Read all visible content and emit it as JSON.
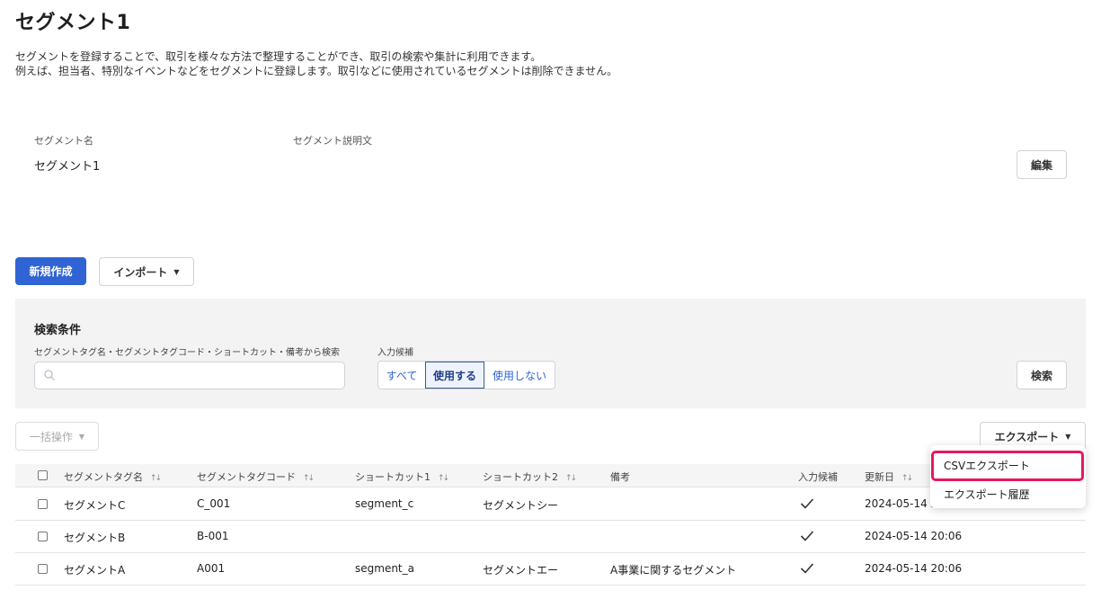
{
  "header": {
    "title": "セグメント1",
    "description_line1": "セグメントを登録することで、取引を様々な方法で整理することができ、取引の検索や集計に利用できます。",
    "description_line2": "例えば、担当者、特別なイベントなどをセグメントに登録します。取引などに使用されているセグメントは削除できません。"
  },
  "info": {
    "name_label": "セグメント名",
    "name_value": "セグメント1",
    "desc_label": "セグメント説明文",
    "edit_button": "編集"
  },
  "actions": {
    "new_button": "新規作成",
    "import_button": "インポート"
  },
  "search": {
    "title": "検索条件",
    "keyword_label": "セグメントタグ名・セグメントタグコード・ショートカット・備考から検索",
    "keyword_value": "",
    "candidate_label": "入力候補",
    "options": [
      "すべて",
      "使用する",
      "使用しない"
    ],
    "selected_option": "使用する",
    "search_button": "検索"
  },
  "toolbar": {
    "bulk_button": "一括操作",
    "export_button": "エクスポート"
  },
  "export_menu": {
    "items": [
      "CSVエクスポート",
      "エクスポート履歴"
    ],
    "highlighted": "CSVエクスポート"
  },
  "table": {
    "columns": [
      "セグメントタグ名",
      "セグメントタグコード",
      "ショートカット1",
      "ショートカット2",
      "備考",
      "入力候補",
      "更新日"
    ],
    "rows": [
      {
        "name": "セグメントC",
        "code": "C_001",
        "shortcut1": "segment_c",
        "shortcut2": "セグメントシー",
        "note": "",
        "candidate": true,
        "updated": "2024-05-14 20:06"
      },
      {
        "name": "セグメントB",
        "code": "B-001",
        "shortcut1": "",
        "shortcut2": "",
        "note": "",
        "candidate": true,
        "updated": "2024-05-14 20:06"
      },
      {
        "name": "セグメントA",
        "code": "A001",
        "shortcut1": "segment_a",
        "shortcut2": "セグメントエー",
        "note": "A事業に関するセグメント",
        "candidate": true,
        "updated": "2024-05-14 20:06"
      }
    ]
  },
  "colors": {
    "primary": "#3064d4",
    "highlight_border": "#e8185e",
    "panel_bg": "#f3f3f3"
  }
}
